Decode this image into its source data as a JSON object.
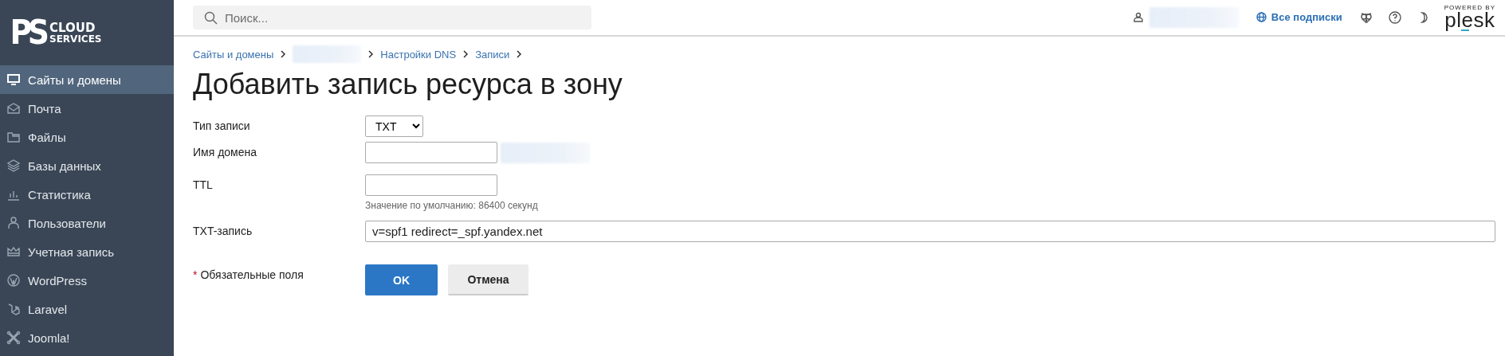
{
  "logo": {
    "mark": "PS",
    "line1": "CLOUD",
    "line2": "SERVICES"
  },
  "sidebar": {
    "items": [
      {
        "label": "Сайты и домены",
        "selected": true
      },
      {
        "label": "Почта",
        "selected": false
      },
      {
        "label": "Файлы",
        "selected": false
      },
      {
        "label": "Базы данных",
        "selected": false
      },
      {
        "label": "Статистика",
        "selected": false
      },
      {
        "label": "Пользователи",
        "selected": false
      },
      {
        "label": "Учетная запись",
        "selected": false
      },
      {
        "label": "WordPress",
        "selected": false
      },
      {
        "label": "Laravel",
        "selected": false
      },
      {
        "label": "Joomla!",
        "selected": false
      }
    ]
  },
  "topbar": {
    "search": {
      "placeholder": "Поиск..."
    },
    "user_redacted": true,
    "subscriptions_link": "Все подписки",
    "plesk": {
      "powered_by": "POWERED BY",
      "name": "plesk"
    }
  },
  "breadcrumbs": [
    {
      "kind": "link",
      "label": "Сайты и домены"
    },
    {
      "kind": "redacted"
    },
    {
      "kind": "link",
      "label": "Настройки DNS"
    },
    {
      "kind": "link",
      "label": "Записи"
    }
  ],
  "title": "Добавить запись ресурса в зону",
  "form": {
    "fields": [
      {
        "kind": "select",
        "label": "Тип записи",
        "value": "TXT"
      },
      {
        "kind": "text",
        "label": "Имя домена",
        "suffix_redacted": true
      },
      {
        "kind": "text",
        "label": "TTL",
        "hint": "Значение по умолчанию: 86400 секунд"
      },
      {
        "kind": "wide",
        "label": "TXT-запись",
        "value": "v=spf1 redirect=_spf.yandex.net"
      }
    ],
    "required_mark": "*",
    "required_note": "Обязательные поля",
    "buttons": [
      {
        "kind": "primary",
        "label": "OK"
      },
      {
        "kind": "secondary",
        "label": "Отмена"
      }
    ]
  }
}
